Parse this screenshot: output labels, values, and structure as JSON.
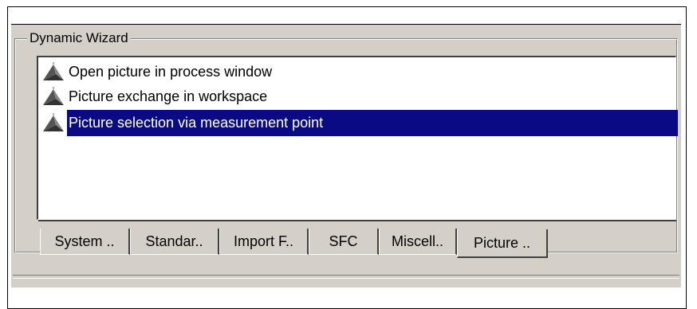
{
  "group": {
    "label": "Dynamic Wizard"
  },
  "list": {
    "items": [
      {
        "label": "Open picture in process window",
        "icon": "wizard-icon",
        "selected": false
      },
      {
        "label": "Picture exchange in workspace",
        "icon": "wizard-icon",
        "selected": false
      },
      {
        "label": "Picture selection via measurement point",
        "icon": "wizard-icon",
        "selected": true
      }
    ]
  },
  "tabs": [
    {
      "label": "System .."
    },
    {
      "label": "Standar.."
    },
    {
      "label": "Import F.."
    },
    {
      "label": "SFC"
    },
    {
      "label": "Miscell.."
    },
    {
      "label": "Picture ..",
      "active": true
    }
  ],
  "colors": {
    "panel": "#d4d0c8",
    "selection": "#0a0a84",
    "list_background": "#ffffff"
  }
}
